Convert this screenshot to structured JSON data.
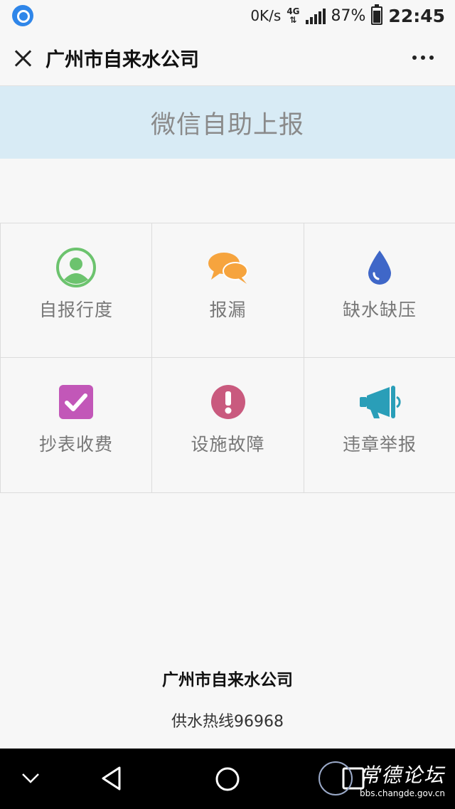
{
  "status_bar": {
    "net_speed": "0K/s",
    "net_type": "4G",
    "battery": "87%",
    "time": "22:45"
  },
  "nav": {
    "title": "广州市自来水公司"
  },
  "banner": {
    "title": "微信自助上报"
  },
  "grid": [
    {
      "label": "自报行度",
      "icon": "user-icon",
      "color": "#6cc36e"
    },
    {
      "label": "报漏",
      "icon": "chat-bubbles-icon",
      "color": "#f6a43e"
    },
    {
      "label": "缺水缺压",
      "icon": "water-drop-icon",
      "color": "#3f67c8"
    },
    {
      "label": "抄表收费",
      "icon": "checkbox-icon",
      "color": "#c257b8"
    },
    {
      "label": "设施故障",
      "icon": "exclamation-icon",
      "color": "#c95a7e"
    },
    {
      "label": "违章举报",
      "icon": "megaphone-icon",
      "color": "#2a9eb8"
    }
  ],
  "footer": {
    "company": "广州市自来水公司",
    "hotline": "供水热线96968"
  },
  "watermark": {
    "name": "常德论坛",
    "url": "bbs.changde.gov.cn"
  }
}
